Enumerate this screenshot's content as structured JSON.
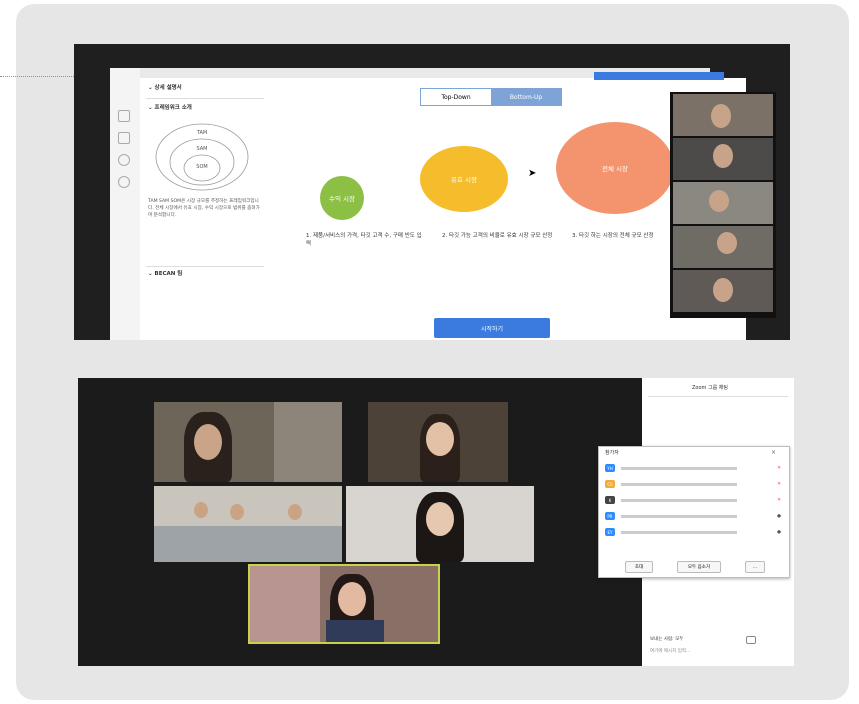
{
  "top": {
    "panel_items": [
      "상세 설명서",
      "프레임워크 소개",
      "BECAN 팀"
    ],
    "diagram_labels": [
      "TAM",
      "SAM",
      "SOM"
    ],
    "panel_body": "TAM SAM SOM은 시장 규모를 추정하는 프레임워크입니다. 전체 시장에서 유효 시장, 수익 시장으로 범위를 좁혀가며 분석합니다.",
    "toggle": [
      "Top-Down",
      "Bottom-Up"
    ],
    "circles": [
      "수익 시장",
      "유효 시장",
      "전체 시장"
    ],
    "captions": [
      "1. 제품/서비스의 가격, 타깃 고객 수, 구매 빈도 입력",
      "2. 타깃 가능 고객의 비율로 유효 시장 규모 산정",
      "3. 타깃 하는 시장의 전체 규모 산정"
    ],
    "start_button": "시작하기",
    "colors": {
      "green": "#8cc045",
      "yellow": "#f5bd2b",
      "orange": "#f4946f",
      "blue": "#3b7be0"
    }
  },
  "bottom": {
    "sidebar_title": "Zoom 그룹 채팅",
    "popup_title": "참가자",
    "participants": [
      {
        "initials": "YH",
        "color": "#2d8cff"
      },
      {
        "initials": "CS",
        "color": "#f2a93b"
      },
      {
        "initials": "K",
        "color": "#444444"
      },
      {
        "initials": "PR",
        "color": "#2d8cff"
      },
      {
        "initials": "EY",
        "color": "#2d8cff"
      }
    ],
    "popup_buttons": [
      "초대",
      "모두 음소거",
      "..."
    ],
    "chat_to": "보내는 사람: 모두",
    "chat_placeholder": "여기에 메시지 입력..."
  }
}
